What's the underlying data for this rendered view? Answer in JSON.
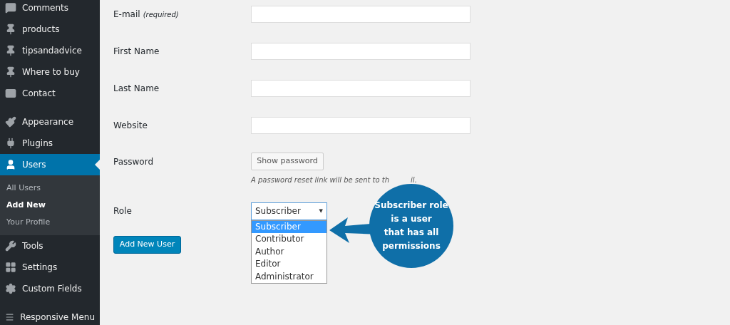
{
  "sidebar": {
    "groups": [
      [
        {
          "label": "Comments",
          "selected": false
        },
        {
          "label": "products",
          "selected": false
        },
        {
          "label": "tipsandadvice",
          "selected": false
        },
        {
          "label": "Where to buy",
          "selected": false
        },
        {
          "label": "Contact",
          "selected": false
        }
      ],
      [
        {
          "label": "Appearance",
          "selected": false
        },
        {
          "label": "Plugins",
          "selected": false
        },
        {
          "label": "Users",
          "selected": true,
          "children": [
            {
              "label": "All Users",
              "selected": false
            },
            {
              "label": "Add New",
              "selected": true
            },
            {
              "label": "Your Profile",
              "selected": false
            }
          ]
        },
        {
          "label": "Tools",
          "selected": false
        },
        {
          "label": "Settings",
          "selected": false
        },
        {
          "label": "Custom Fields",
          "selected": false
        }
      ],
      [
        {
          "label": "Responsive Menu",
          "selected": false
        }
      ]
    ]
  },
  "form": {
    "fields": [
      {
        "kind": "text",
        "label": "E-mail",
        "note": "(required)"
      },
      {
        "kind": "text",
        "label": "First Name"
      },
      {
        "kind": "text",
        "label": "Last Name"
      },
      {
        "kind": "text",
        "label": "Website"
      },
      {
        "kind": "password",
        "label": "Password",
        "button": "Show password",
        "hint": [
          "A password reset link will be sent to th",
          "il."
        ]
      },
      {
        "kind": "select",
        "label": "Role",
        "value": "Subscriber",
        "caret": "▼",
        "options": [
          {
            "label": "Subscriber",
            "selected": true
          },
          {
            "label": "Contributor",
            "selected": false
          },
          {
            "label": "Author",
            "selected": false
          },
          {
            "label": "Editor",
            "selected": false
          },
          {
            "label": "Administrator",
            "selected": false
          }
        ]
      }
    ],
    "submit": "Add New User"
  },
  "callout": {
    "text": [
      "Subscriber role",
      "is a user",
      "that has all",
      "permissions"
    ]
  }
}
